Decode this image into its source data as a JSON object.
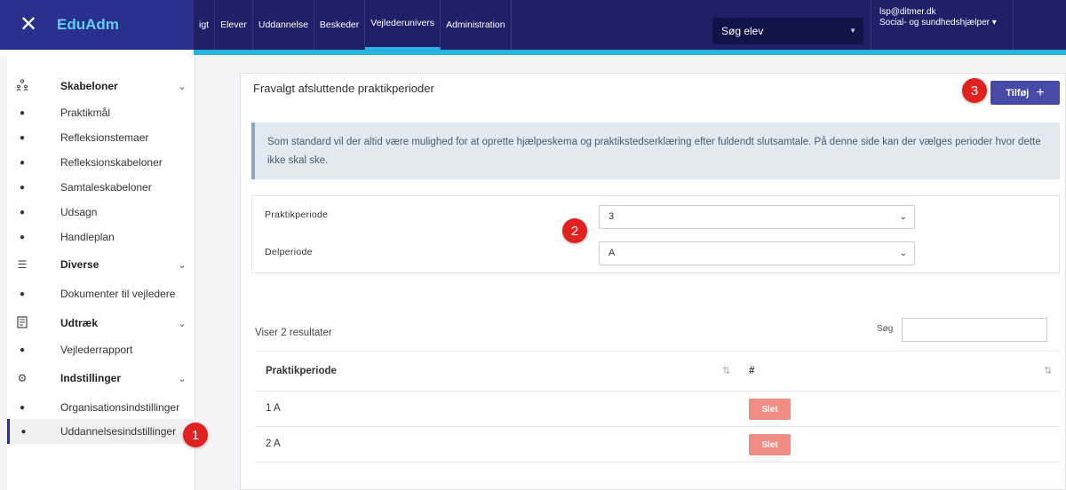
{
  "app": {
    "brand": "EduAdm",
    "close_glyph": "✕"
  },
  "nav": {
    "items": [
      "igt",
      "Elever",
      "Uddannelse",
      "Beskeder",
      "Vejlederunivers",
      "Administration"
    ],
    "active_index": 4
  },
  "search_student": {
    "label": "Søg elev"
  },
  "user": {
    "email": "lsp@ditmer.dk",
    "role": "Social- og sundhedshjælper"
  },
  "sidebar": {
    "groups": [
      {
        "label": "Skabeloner",
        "icon": "people-tree-icon",
        "items": [
          "Praktikmål",
          "Refleksionstemaer",
          "Refleksionskabeloner",
          "Samtaleskabeloner",
          "Udsagn",
          "Handleplan"
        ]
      },
      {
        "label": "Diverse",
        "icon": "list-icon",
        "items": [
          "Dokumenter til vejledere"
        ]
      },
      {
        "label": "Udtræk",
        "icon": "document-icon",
        "items": [
          "Vejlederrapport"
        ]
      },
      {
        "label": "Indstillinger",
        "icon": "settings-icon",
        "items": [
          "Organisationsindstillinger",
          "Uddannelsesindstillinger"
        ]
      }
    ],
    "active_item": "Uddannelsesindstillinger"
  },
  "main": {
    "title": "Fravalgt afsluttende praktikperioder",
    "add_button": "Tilføj",
    "info": "Som standard vil der altid være mulighed for at oprette hjælpeskema og praktikstedserklæring efter fuldendt slutsamtale. På denne side kan der vælges perioder hvor dette ikke skal ske.",
    "filters": [
      {
        "label": "Praktikperiode",
        "value": "3"
      },
      {
        "label": "Delperiode",
        "value": "A"
      }
    ],
    "results_text": "Viser 2 resultater",
    "search_label": "Søg",
    "table": {
      "headers": [
        "Praktikperiode",
        "#"
      ],
      "rows": [
        {
          "period": "1 A",
          "action": "Slet"
        },
        {
          "period": "2 A",
          "action": "Slet"
        }
      ]
    }
  },
  "markers": [
    "1",
    "2",
    "3"
  ],
  "colors": {
    "nav_bg": "#1e2168",
    "accent": "#29b4e0",
    "primary_button": "#474aa6",
    "delete_button": "#f28b82",
    "marker": "#e32020"
  }
}
